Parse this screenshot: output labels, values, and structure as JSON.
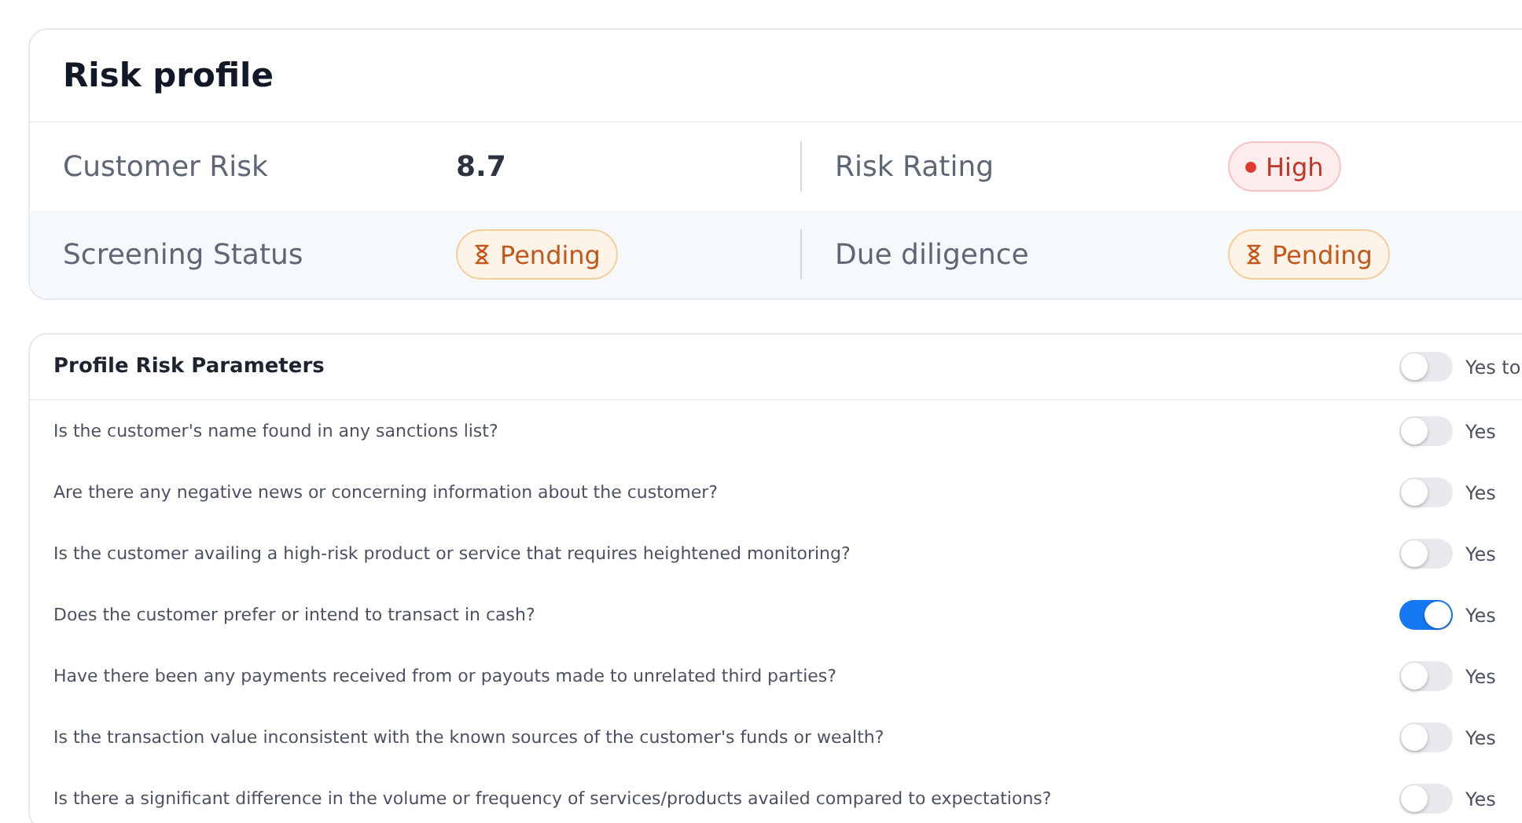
{
  "risk_profile": {
    "title": "Risk profile",
    "rows": [
      [
        {
          "label": "Customer Risk",
          "kind": "text",
          "value": "8.7"
        },
        {
          "label": "Risk Rating",
          "kind": "high",
          "value": "High"
        }
      ],
      [
        {
          "label": "Screening Status",
          "kind": "pending",
          "value": "Pending"
        },
        {
          "label": "Due diligence",
          "kind": "pending",
          "value": "Pending"
        }
      ]
    ]
  },
  "parameters": {
    "title": "Profile Risk Parameters",
    "all_toggle": {
      "on": false,
      "label": "Yes to"
    },
    "questions": [
      {
        "text": "Is the customer's name found in any sanctions list?",
        "on": false,
        "label": "Yes"
      },
      {
        "text": "Are there any negative news or concerning information about the customer?",
        "on": false,
        "label": "Yes"
      },
      {
        "text": "Is the customer availing a high-risk product or service that requires heightened monitoring?",
        "on": false,
        "label": "Yes"
      },
      {
        "text": "Does the customer prefer or intend to transact in cash?",
        "on": true,
        "label": "Yes"
      },
      {
        "text": "Have there been any payments received from or payouts made to unrelated third parties?",
        "on": false,
        "label": "Yes"
      },
      {
        "text": "Is the transaction value inconsistent with the known sources of the customer's funds or wealth?",
        "on": false,
        "label": "Yes"
      },
      {
        "text": "Is there a significant difference in the volume or frequency of services/products availed compared to expectations?",
        "on": false,
        "label": "Yes"
      }
    ]
  }
}
